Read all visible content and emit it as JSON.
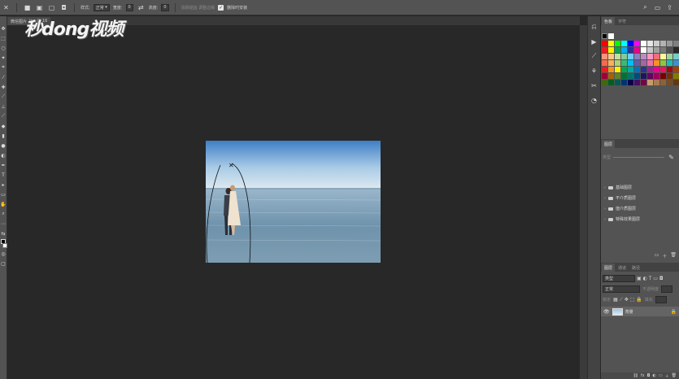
{
  "options_bar": {
    "style_label": "样式:",
    "style_value": "正常",
    "width_label": "宽度:",
    "width_value": "0",
    "height_label": "高度:",
    "height_value": "0",
    "disabled_option": "消除锯齿 调整边缘",
    "checkbox_label": "删除时安装"
  },
  "doc_tab": {
    "label": "微信图片",
    "file": "jpg @ 16"
  },
  "watermark": "秒dong视频",
  "panels": {
    "swatch_tabs": [
      "色板",
      "字符"
    ],
    "styles_tabs": [
      "图层"
    ],
    "style_groups": [
      "基础图层",
      "不介质图层",
      "值介质图层",
      "特殊效果图层"
    ],
    "layers_tabs": [
      "图层",
      "通道",
      "路径"
    ],
    "search_placeholder": "类型",
    "blend_mode": "正常",
    "opacity_label": "不透明度",
    "lock_label": "锁定",
    "fill_label": "填充",
    "layer_name": "背景"
  },
  "colors": {
    "swatch_grid": [
      "#ff0000",
      "#ffff00",
      "#00ff00",
      "#00ffff",
      "#0000ff",
      "#ff00ff",
      "#ffffff",
      "#e6e6e6",
      "#cccccc",
      "#b3b3b3",
      "#999999",
      "#808080",
      "#ed1c24",
      "#fff200",
      "#00a651",
      "#00aeef",
      "#2e3192",
      "#ec008c",
      "#ffffff",
      "#c8c8c8",
      "#a0a0a0",
      "#787878",
      "#505050",
      "#282828",
      "#f7977a",
      "#fdc68a",
      "#c4df9b",
      "#82ca9c",
      "#6ecff6",
      "#8781bd",
      "#bd8cbf",
      "#f49ac1",
      "#f26d7d",
      "#fff79a",
      "#a2d39c",
      "#7accc8",
      "#f26c4f",
      "#fbaf5d",
      "#acd373",
      "#3cb878",
      "#00bff3",
      "#605ca8",
      "#a864a8",
      "#f06eaa",
      "#f7941d",
      "#8dc73f",
      "#1cbbb4",
      "#448ccb",
      "#ed1c24",
      "#f7941d",
      "#fff200",
      "#00a651",
      "#00a99d",
      "#0072bc",
      "#2e3192",
      "#92278f",
      "#ec008c",
      "#ed145b",
      "#9e0b0f",
      "#a0410d",
      "#9e0039",
      "#a36209",
      "#598527",
      "#007236",
      "#00746b",
      "#004a80",
      "#1b1464",
      "#630460",
      "#9e005d",
      "#790000",
      "#7b2e00",
      "#827b00",
      "#406618",
      "#005e20",
      "#005952",
      "#003471",
      "#0d004c",
      "#440e62",
      "#790047",
      "#c69c6d",
      "#a67c52",
      "#8c6239",
      "#754c24",
      "#603913"
    ]
  }
}
